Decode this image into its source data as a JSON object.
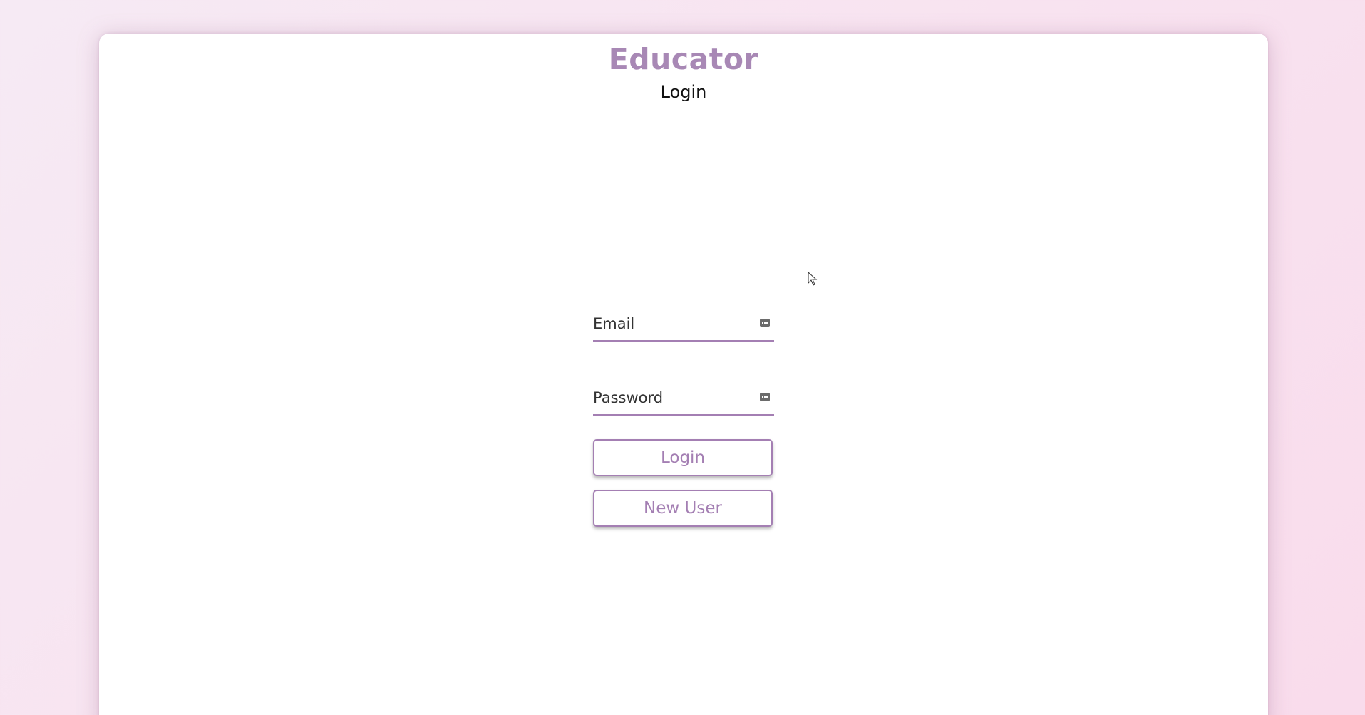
{
  "app": {
    "brand": "Educator",
    "subtitle": "Login"
  },
  "form": {
    "email": {
      "placeholder": "Email",
      "value": "",
      "icon": "password-manager-icon"
    },
    "password": {
      "placeholder": "Password",
      "value": "",
      "icon": "password-manager-icon"
    },
    "login_label": "Login",
    "new_user_label": "New User"
  },
  "colors": {
    "accent": "#a47fb3",
    "brand": "#a888b5",
    "background": "#f8e3f0"
  }
}
